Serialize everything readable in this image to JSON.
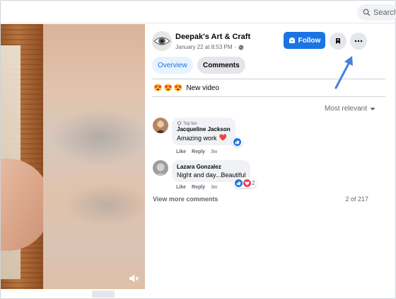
{
  "search": {
    "label": "Search"
  },
  "post": {
    "page_name": "Deepak's Art & Craft",
    "timestamp": "January 22 at 8:53 PM",
    "privacy_icon": "globe-icon",
    "follow_label": "Follow",
    "caption_emojis": [
      "😍",
      "😍",
      "😍"
    ],
    "caption_text": "New video"
  },
  "tabs": [
    {
      "label": "Overview",
      "active": true
    },
    {
      "label": "Comments",
      "active": false
    }
  ],
  "sort": {
    "label": "Most relevant"
  },
  "comments": [
    {
      "badge": "Top fan",
      "author": "Jacqueline Jackson",
      "text": "Amazing work",
      "emoji": "❤️",
      "like": "Like",
      "reply": "Reply",
      "age": "3w",
      "reactions": [
        "like"
      ]
    },
    {
      "author": "Lazara Gonzalez",
      "text": "Night and day...Beautiful",
      "like": "Like",
      "reply": "Reply",
      "age": "3w",
      "reactions": [
        "like",
        "love"
      ],
      "reaction_count": "2"
    }
  ],
  "footer": {
    "view_more": "View more comments",
    "count": "2 of 217"
  },
  "colors": {
    "accent": "#1b74e4",
    "tab_active_bg": "#e7f3ff",
    "annotation_arrow": "#4a7fe0"
  }
}
